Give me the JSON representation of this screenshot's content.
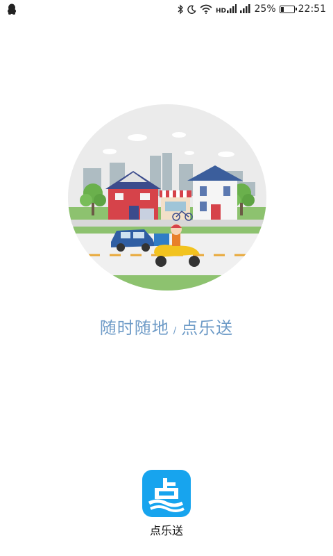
{
  "status_bar": {
    "battery_percent": "25%",
    "battery_level": 0.25,
    "time": "22:51",
    "icons": [
      "qq-penguin-icon",
      "bluetooth-icon",
      "moon-icon",
      "wifi-icon",
      "hd-icon",
      "signal-icon",
      "signal-icon",
      "battery-icon"
    ]
  },
  "splash": {
    "slogan_left": "随时随地",
    "slogan_separator": "/",
    "slogan_right": "点乐送"
  },
  "app": {
    "name": "点乐送",
    "icon_color": "#17a4ee"
  },
  "colors": {
    "slogan": "#6e9bc7",
    "circle_bg": "#ebebeb"
  }
}
